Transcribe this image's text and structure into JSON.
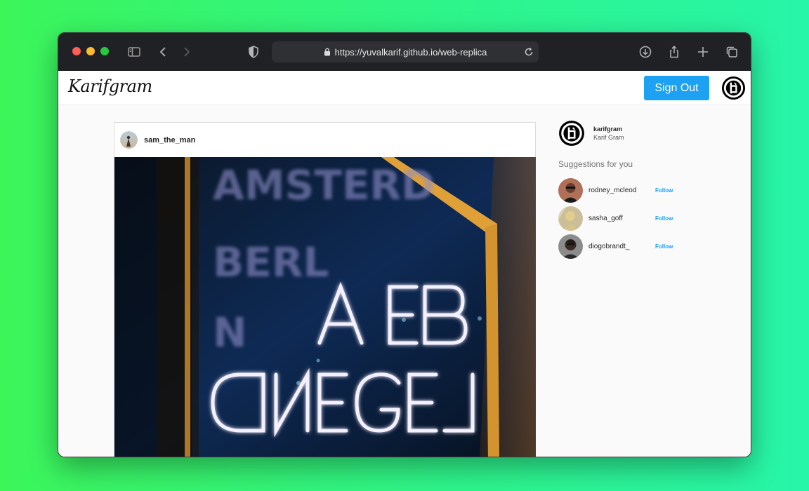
{
  "browser": {
    "url": "https://yuvalkarif.github.io/web-replica"
  },
  "nav": {
    "logo": "Karifgram",
    "signout_label": "Sign Out"
  },
  "post": {
    "username": "sam_the_man"
  },
  "sidebar": {
    "username": "karifgram",
    "fullname": "Karif Gram",
    "suggestions_title": "Suggestions for you",
    "suggestions": [
      {
        "username": "rodney_mcleod",
        "follow_label": "Follow"
      },
      {
        "username": "sasha_goff",
        "follow_label": "Follow"
      },
      {
        "username": "diogobrandt_",
        "follow_label": "Follow"
      }
    ]
  },
  "colors": {
    "accent": "#1da1f2",
    "chrome": "#202124"
  }
}
